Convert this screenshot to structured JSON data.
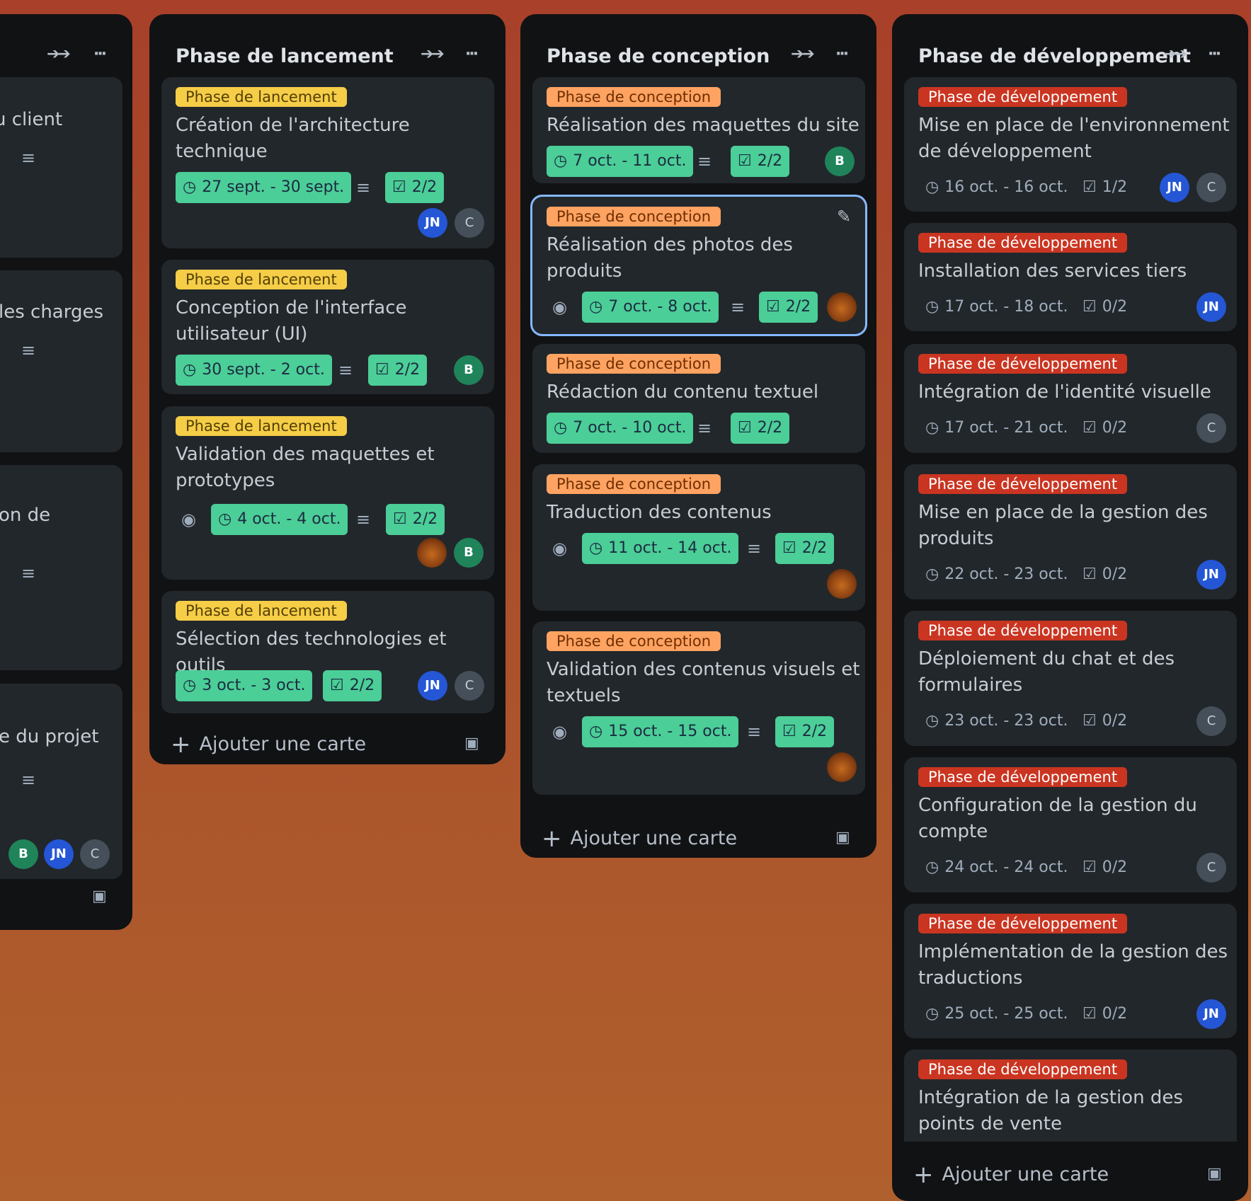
{
  "lists": {
    "partial": {
      "cards": [
        {
          "title_fragment": "u client"
        },
        {
          "title_fragment": "les charges"
        },
        {
          "title_fragment": "on de"
        },
        {
          "title_fragment": "e du projet",
          "avatars": [
            "B",
            "JN",
            "C"
          ]
        }
      ]
    },
    "lancement": {
      "title": "Phase de lancement",
      "add_card": "Ajouter une carte",
      "cards": [
        {
          "label": "Phase de lancement",
          "title": [
            "Création de l'architecture",
            "technique"
          ],
          "date": "27 sept. - 30 sept.",
          "checklist": "2/2",
          "avatars": [
            "JN",
            "C"
          ]
        },
        {
          "label": "Phase de lancement",
          "title": [
            "Conception de l'interface",
            "utilisateur (UI)"
          ],
          "date": "30 sept. - 2 oct.",
          "checklist": "2/2",
          "avatars": [
            "B"
          ]
        },
        {
          "label": "Phase de lancement",
          "title": [
            "Validation des maquettes et",
            "prototypes"
          ],
          "date": "4 oct. - 4 oct.",
          "checklist": "2/2",
          "avatars": [
            "B"
          ]
        },
        {
          "label": "Phase de lancement",
          "title": [
            "Sélection des technologies et outils"
          ],
          "date": "3 oct. - 3 oct.",
          "checklist": "2/2",
          "avatars": [
            "JN",
            "C"
          ]
        }
      ]
    },
    "conception": {
      "title": "Phase de conception",
      "add_card": "Ajouter une carte",
      "cards": [
        {
          "label": "Phase de conception",
          "title": [
            "Réalisation des maquettes du site"
          ],
          "date": "7 oct. - 11 oct.",
          "checklist": "2/2",
          "avatars": [
            "B"
          ]
        },
        {
          "label": "Phase de conception",
          "title": [
            "Réalisation des photos des",
            "produits"
          ],
          "date": "7 oct. - 8 oct.",
          "checklist": "2/2"
        },
        {
          "label": "Phase de conception",
          "title": [
            "Rédaction du contenu textuel"
          ],
          "date": "7 oct. - 10 oct.",
          "checklist": "2/2"
        },
        {
          "label": "Phase de conception",
          "title": [
            "Traduction des contenus"
          ],
          "date": "11 oct. - 14 oct.",
          "checklist": "2/2"
        },
        {
          "label": "Phase de conception",
          "title": [
            "Validation des contenus visuels et",
            "textuels"
          ],
          "date": "15 oct. - 15 oct.",
          "checklist": "2/2"
        }
      ]
    },
    "developpement": {
      "title": "Phase de développement",
      "add_card": "Ajouter une carte",
      "cards": [
        {
          "label": "Phase de développement",
          "title": [
            "Mise en place de l'environnement",
            "de développement"
          ],
          "date": "16 oct. - 16 oct.",
          "checklist": "1/2",
          "avatars": [
            "JN",
            "C"
          ]
        },
        {
          "label": "Phase de développement",
          "title": [
            "Installation des services tiers"
          ],
          "date": "17 oct. - 18 oct.",
          "checklist": "0/2",
          "avatars": [
            "JN"
          ]
        },
        {
          "label": "Phase de développement",
          "title": [
            "Intégration de l'identité visuelle"
          ],
          "date": "17 oct. - 21 oct.",
          "checklist": "0/2",
          "avatars": [
            "C"
          ]
        },
        {
          "label": "Phase de développement",
          "title": [
            "Mise en place de la gestion des",
            "produits"
          ],
          "date": "22 oct. - 23 oct.",
          "checklist": "0/2",
          "avatars": [
            "JN"
          ]
        },
        {
          "label": "Phase de développement",
          "title": [
            "Déploiement du chat et des",
            "formulaires"
          ],
          "date": "23 oct. - 23 oct.",
          "checklist": "0/2",
          "avatars": [
            "C"
          ]
        },
        {
          "label": "Phase de développement",
          "title": [
            "Configuration de la gestion du",
            "compte"
          ],
          "date": "24 oct. - 24 oct.",
          "checklist": "0/2",
          "avatars": [
            "C"
          ]
        },
        {
          "label": "Phase de développement",
          "title": [
            "Implémentation de la gestion des",
            "traductions"
          ],
          "date": "25 oct. - 25 oct.",
          "checklist": "0/2",
          "avatars": [
            "JN"
          ]
        },
        {
          "label": "Phase de développement",
          "title": [
            "Intégration de la gestion des",
            "points de vente"
          ]
        }
      ]
    }
  },
  "icons": {
    "collapse": "collapse-arrows-icon",
    "more": "more-dots-icon",
    "clock": "clock-icon",
    "checklist": "checklist-icon",
    "description": "description-icon",
    "watch": "eye-icon",
    "template": "card-template-icon",
    "edit": "pencil-icon"
  },
  "colors": {
    "label_lancement": "#f5cd47",
    "label_conception": "#fea362",
    "label_developpement": "#ca3521",
    "badge_complete": "#4bce97",
    "list_bg": "#111214",
    "card_bg": "#22272b"
  }
}
